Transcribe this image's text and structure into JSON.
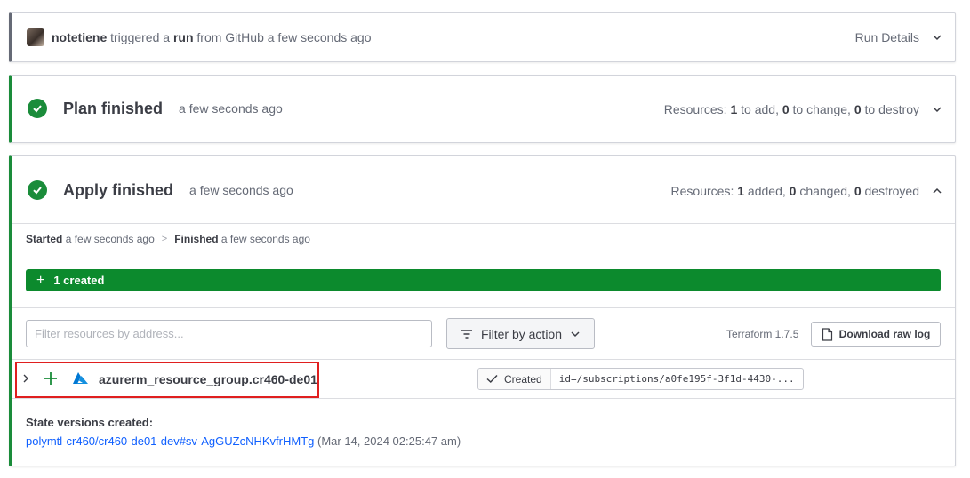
{
  "run_header": {
    "user": "notetiene",
    "triggered_text": "triggered a",
    "run_word": "run",
    "from_text": "from GitHub a few seconds ago",
    "details_label": "Run Details"
  },
  "plan": {
    "title": "Plan finished",
    "time": "a few seconds ago",
    "resources_prefix": "Resources:",
    "add_count": "1",
    "add_text": "to add,",
    "change_count": "0",
    "change_text": "to change,",
    "destroy_count": "0",
    "destroy_text": "to destroy"
  },
  "apply": {
    "title": "Apply finished",
    "time": "a few seconds ago",
    "resources_prefix": "Resources:",
    "added_count": "1",
    "added_text": "added,",
    "changed_count": "0",
    "changed_text": "changed,",
    "destroyed_count": "0",
    "destroyed_text": "destroyed",
    "started_label": "Started",
    "started_time": "a few seconds ago",
    "finished_label": "Finished",
    "finished_time": "a few seconds ago",
    "created_bar_label": "1 created",
    "filter_placeholder": "Filter resources by address...",
    "filter_action_label": "Filter by action",
    "terraform_version": "Terraform 1.7.5",
    "download_label": "Download raw log",
    "resource": {
      "address": "azurerm_resource_group.cr460-de01",
      "status": "Created",
      "id": "id=/subscriptions/a0fe195f-3f1d-4430-..."
    },
    "state_versions_label": "State versions created:",
    "state_link": "polymtl-cr460/cr460-de01-dev#sv-AgGUZcNHKvfrHMTg",
    "state_date": "(Mar 14, 2024 02:25:47 am)"
  },
  "colors": {
    "success_green": "#1a8c3a",
    "bar_green": "#0c8a2d",
    "highlight_red": "#e01f1f",
    "link_blue": "#1060ff",
    "azure_blue": "#0078d4"
  },
  "icons": [
    "avatar",
    "chevron-down-icon",
    "chevron-up-icon",
    "check-circle-icon",
    "plus-icon",
    "filter-icon",
    "file-icon",
    "chevron-right-icon",
    "azure-icon",
    "checkmark-icon"
  ]
}
